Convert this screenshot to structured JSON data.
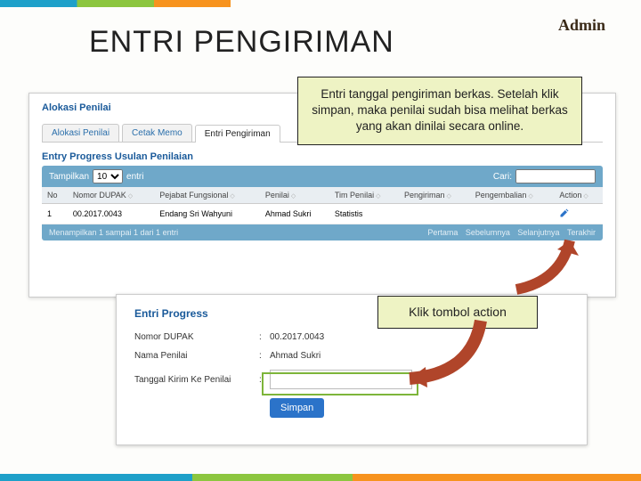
{
  "title": "ENTRI PENGIRIMAN",
  "role": "Admin",
  "panel": {
    "title": "Alokasi Penilai",
    "tabs": [
      "Alokasi Penilai",
      "Cetak Memo",
      "Entri Pengiriman"
    ],
    "section": "Entry Progress Usulan Penilaian",
    "toolbar": {
      "show_label": "Tampilkan",
      "per_page": "10",
      "per_page_suffix": "entri",
      "search_label": "Cari:"
    },
    "columns": [
      "No",
      "Nomor DUPAK",
      "Pejabat Fungsional",
      "Penilai",
      "Tim Penilai",
      "Pengiriman",
      "Pengembalian",
      "Action"
    ],
    "row": {
      "no": "1",
      "nomor": "00.2017.0043",
      "pejabat": "Endang Sri Wahyuni",
      "penilai": "Ahmad Sukri",
      "tim": "Statistis",
      "pengiriman": "",
      "pengembalian": ""
    },
    "pager": {
      "info": "Menampilkan 1 sampai 1 dari 1 entri",
      "nav": [
        "Pertama",
        "Sebelumnya",
        "Selanjutnya",
        "Terakhir"
      ]
    }
  },
  "form": {
    "title": "Entri Progress",
    "rows": [
      {
        "label": "Nomor DUPAK",
        "value": "00.2017.0043"
      },
      {
        "label": "Nama Penilai",
        "value": "Ahmad Sukri"
      },
      {
        "label": "Tanggal Kirim Ke Penilai",
        "value": ""
      }
    ],
    "save": "Simpan"
  },
  "callouts": {
    "big": "Entri tanggal pengiriman berkas. Setelah klik simpan, maka penilai sudah bisa melihat berkas yang akan dinilai secara online.",
    "small": "Klik tombol action"
  }
}
